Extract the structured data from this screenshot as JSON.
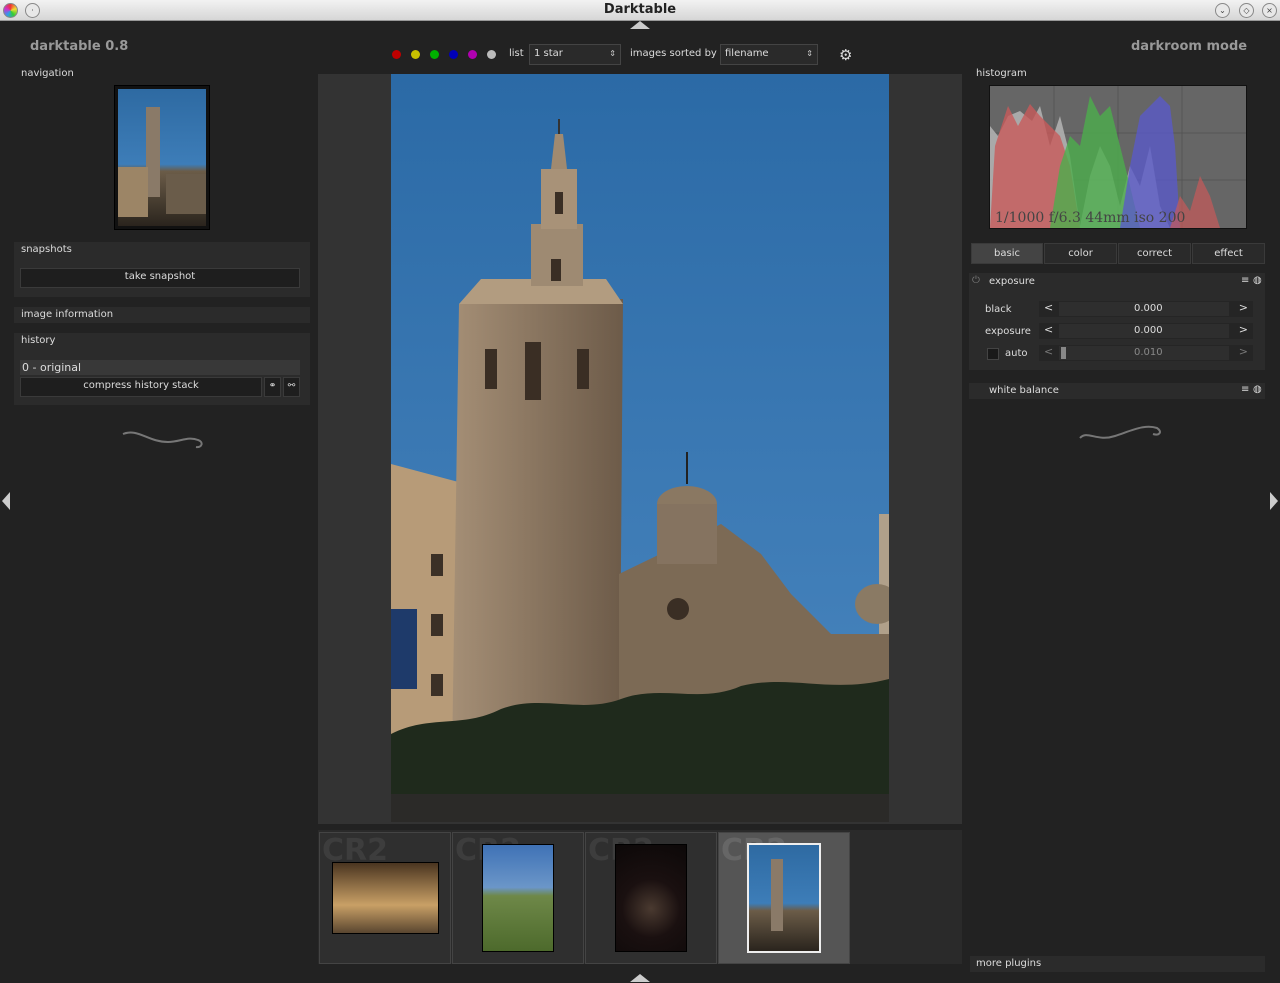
{
  "window": {
    "title": "Darktable"
  },
  "header": {
    "app_version": "darktable 0.8",
    "mode": "darkroom mode"
  },
  "toolbar": {
    "color_labels": [
      "#c00000",
      "#c8c000",
      "#00b000",
      "#0000b8",
      "#b000b0",
      "#bbbbbb"
    ],
    "list_label": "list",
    "list_value": "1 star",
    "sort_label": "images sorted by",
    "sort_value": "filename"
  },
  "left": {
    "navigation_title": "navigation",
    "snapshots_title": "snapshots",
    "take_snapshot": "take snapshot",
    "image_information": "image information",
    "history_title": "history",
    "history_items": [
      "0 - original"
    ],
    "compress_history": "compress history stack"
  },
  "right": {
    "histogram_title": "histogram",
    "exif": "1/1000 f/6.3 44mm iso 200",
    "tabs": [
      "basic",
      "color",
      "correct",
      "effect"
    ],
    "exposure_title": "exposure",
    "sliders": {
      "black_label": "black",
      "black_value": "0.000",
      "exposure_label": "exposure",
      "exposure_value": "0.000",
      "auto_label": "auto",
      "auto_value": "0.010"
    },
    "white_balance_title": "white balance",
    "more_plugins": "more plugins"
  },
  "filmstrip": {
    "items": [
      {
        "ext": "CR2"
      },
      {
        "ext": "CR2"
      },
      {
        "ext": "CR2"
      },
      {
        "ext": "CR2"
      }
    ]
  }
}
